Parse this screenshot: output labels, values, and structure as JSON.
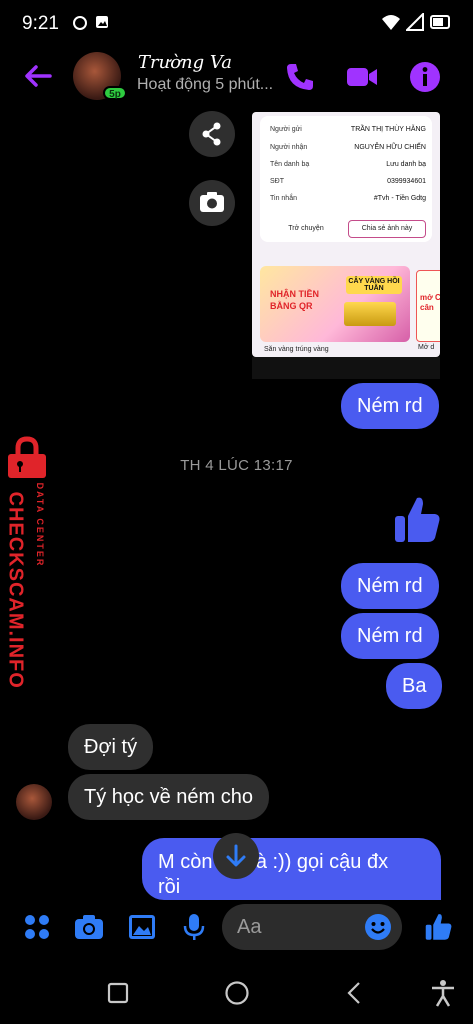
{
  "status_bar": {
    "time": "9:21"
  },
  "header": {
    "contact_name": "Trường Va",
    "status_text": "Hoạt động 5 phút...",
    "active_badge": "5p",
    "accent_color": "#a033ff"
  },
  "shared_image": {
    "rows": [
      {
        "label": "Người gửi",
        "value": "TRẦN THỊ THÙY HẰNG"
      },
      {
        "label": "Người nhận",
        "value": "NGUYỄN HỮU CHIẾN"
      },
      {
        "label": "Tên danh bạ",
        "value": "Lưu danh bạ"
      },
      {
        "label": "SĐT",
        "value": "0399934601"
      },
      {
        "label": "Tin nhắn",
        "value": "#Tvh - Tiền Gdtg"
      }
    ],
    "button_transfer": "Trở chuyện",
    "button_save": "Chia sẻ ảnh này",
    "promo_title": "NHẬN TIỀN BẰNG QR",
    "promo_badge": "CÂY VÀNG HỒI TUẦN",
    "promo_caption": "Săn vàng trúng vàng",
    "promo2_text": "mở C cân",
    "promo2_caption": "Mở d"
  },
  "messages": [
    {
      "dir": "out",
      "text": "Ném rd"
    },
    {
      "dir": "out",
      "text": "Ném rd"
    },
    {
      "dir": "out",
      "text": "Ném rd"
    },
    {
      "dir": "out",
      "text": "Ba"
    },
    {
      "dir": "in",
      "text": "Đợi tý"
    },
    {
      "dir": "in",
      "text": "Tý học về ném cho"
    },
    {
      "dir": "out",
      "text_line1": "M còn học à :)) gọi cậu đx",
      "text_line2": "rồi"
    }
  ],
  "timestamp": "TH 4 LÚC 13:17",
  "watermark": {
    "main": "CHECKSCAM.INFO",
    "sub": "DATA CENTER",
    "color": "#e0242a"
  },
  "composer": {
    "placeholder": "Aa",
    "accent_color": "#2f7cf6"
  },
  "colors": {
    "outgoing_bubble": "#4a5bf0",
    "incoming_bubble": "#2f2f2f"
  }
}
